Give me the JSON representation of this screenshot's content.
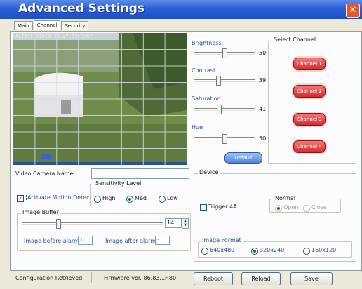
{
  "window": {
    "title": "Advanced Settings",
    "close_glyph": "✕"
  },
  "tabs": [
    {
      "label": "Main"
    },
    {
      "label": "Channel"
    },
    {
      "label": "Security"
    }
  ],
  "video": {
    "overlay_text": "ACTIVE VIDEO 15:27:55 8/07"
  },
  "adjust": {
    "brightness": {
      "label": "Brightness",
      "value": "50",
      "level": 0.5
    },
    "contrast": {
      "label": "Contrast",
      "value": "39",
      "level": 0.39
    },
    "saturation": {
      "label": "Saturation",
      "value": "41",
      "level": 0.41
    },
    "hue": {
      "label": "Hue",
      "value": "50",
      "level": 0.5
    },
    "default_button": "Default"
  },
  "select_channel": {
    "title": "Select Channel",
    "channels": [
      "Channel 1",
      "Channel 2",
      "Channel 3",
      "Channel 4"
    ]
  },
  "camera_name": {
    "label": "Video Camera Name:",
    "value": ""
  },
  "motion": {
    "activate_label": "Activate Motion Detect",
    "activate_checked": true,
    "sensitivity_title": "Sensitivity Level",
    "options": [
      "High",
      "Med",
      "Low"
    ],
    "selected": "Med"
  },
  "image_buffer": {
    "title": "Image Buffer",
    "value": "14",
    "before_label": "Image before alarm:",
    "before_value": "3",
    "after_label": "Image after alarm:",
    "after_value": "3"
  },
  "device": {
    "title": "Device",
    "trigger_label": "Trigger 4A",
    "normal_title": "Normal",
    "normal_options": [
      "Open",
      "Close"
    ],
    "image_format_title": "Image Format",
    "formats": [
      "640x480",
      "320x240",
      "160x120"
    ],
    "format_selected": "320x240"
  },
  "status": {
    "message": "Configuration Retrieved",
    "firmware": "Firmware ver. 86.83.1F.80",
    "buttons": [
      "Reboot",
      "Reload",
      "Save"
    ]
  },
  "colors": {
    "title_bar": "#2a5fd6",
    "channel_button": "#d92b2b",
    "default_button": "#4d7fd9"
  }
}
